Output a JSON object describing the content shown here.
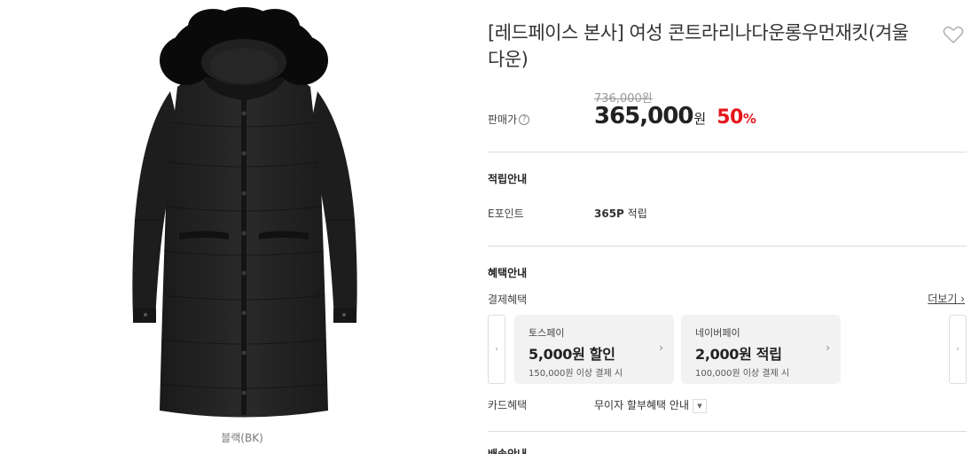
{
  "product": {
    "title": "[레드페이스 본사] 여성 콘트라리나다운롱우먼재킷(겨울다운)",
    "color_caption": "블랙(BK)",
    "wishlist_icon": "heart-outline-icon"
  },
  "price": {
    "label": "판매가",
    "help_icon": "?",
    "original": "736,000원",
    "sale": "365,000",
    "currency": "원",
    "discount": "50",
    "discount_unit": "%",
    "discount_color": "#e5161c"
  },
  "points": {
    "section_title": "적립안내",
    "label": "E포인트",
    "value": "365P",
    "value_suffix": " 적립"
  },
  "benefits": {
    "section_title": "혜택안내",
    "payment_label": "결제혜택",
    "more_label": "더보기",
    "more_arrow": "›",
    "prev_arrow": "‹",
    "next_arrow": "›",
    "cards": [
      {
        "name": "토스페이",
        "main": "5,000원 할인",
        "sub": "150,000원 이상 결제 시",
        "chevron": "›"
      },
      {
        "name": "네이버페이",
        "main": "2,000원 적립",
        "sub": "100,000원 이상 결제 시",
        "chevron": "›"
      }
    ],
    "card_label": "카드혜택",
    "card_value": "무이자 할부혜택 안내",
    "card_toggle": "▼"
  },
  "shipping": {
    "section_title": "배송안내"
  }
}
